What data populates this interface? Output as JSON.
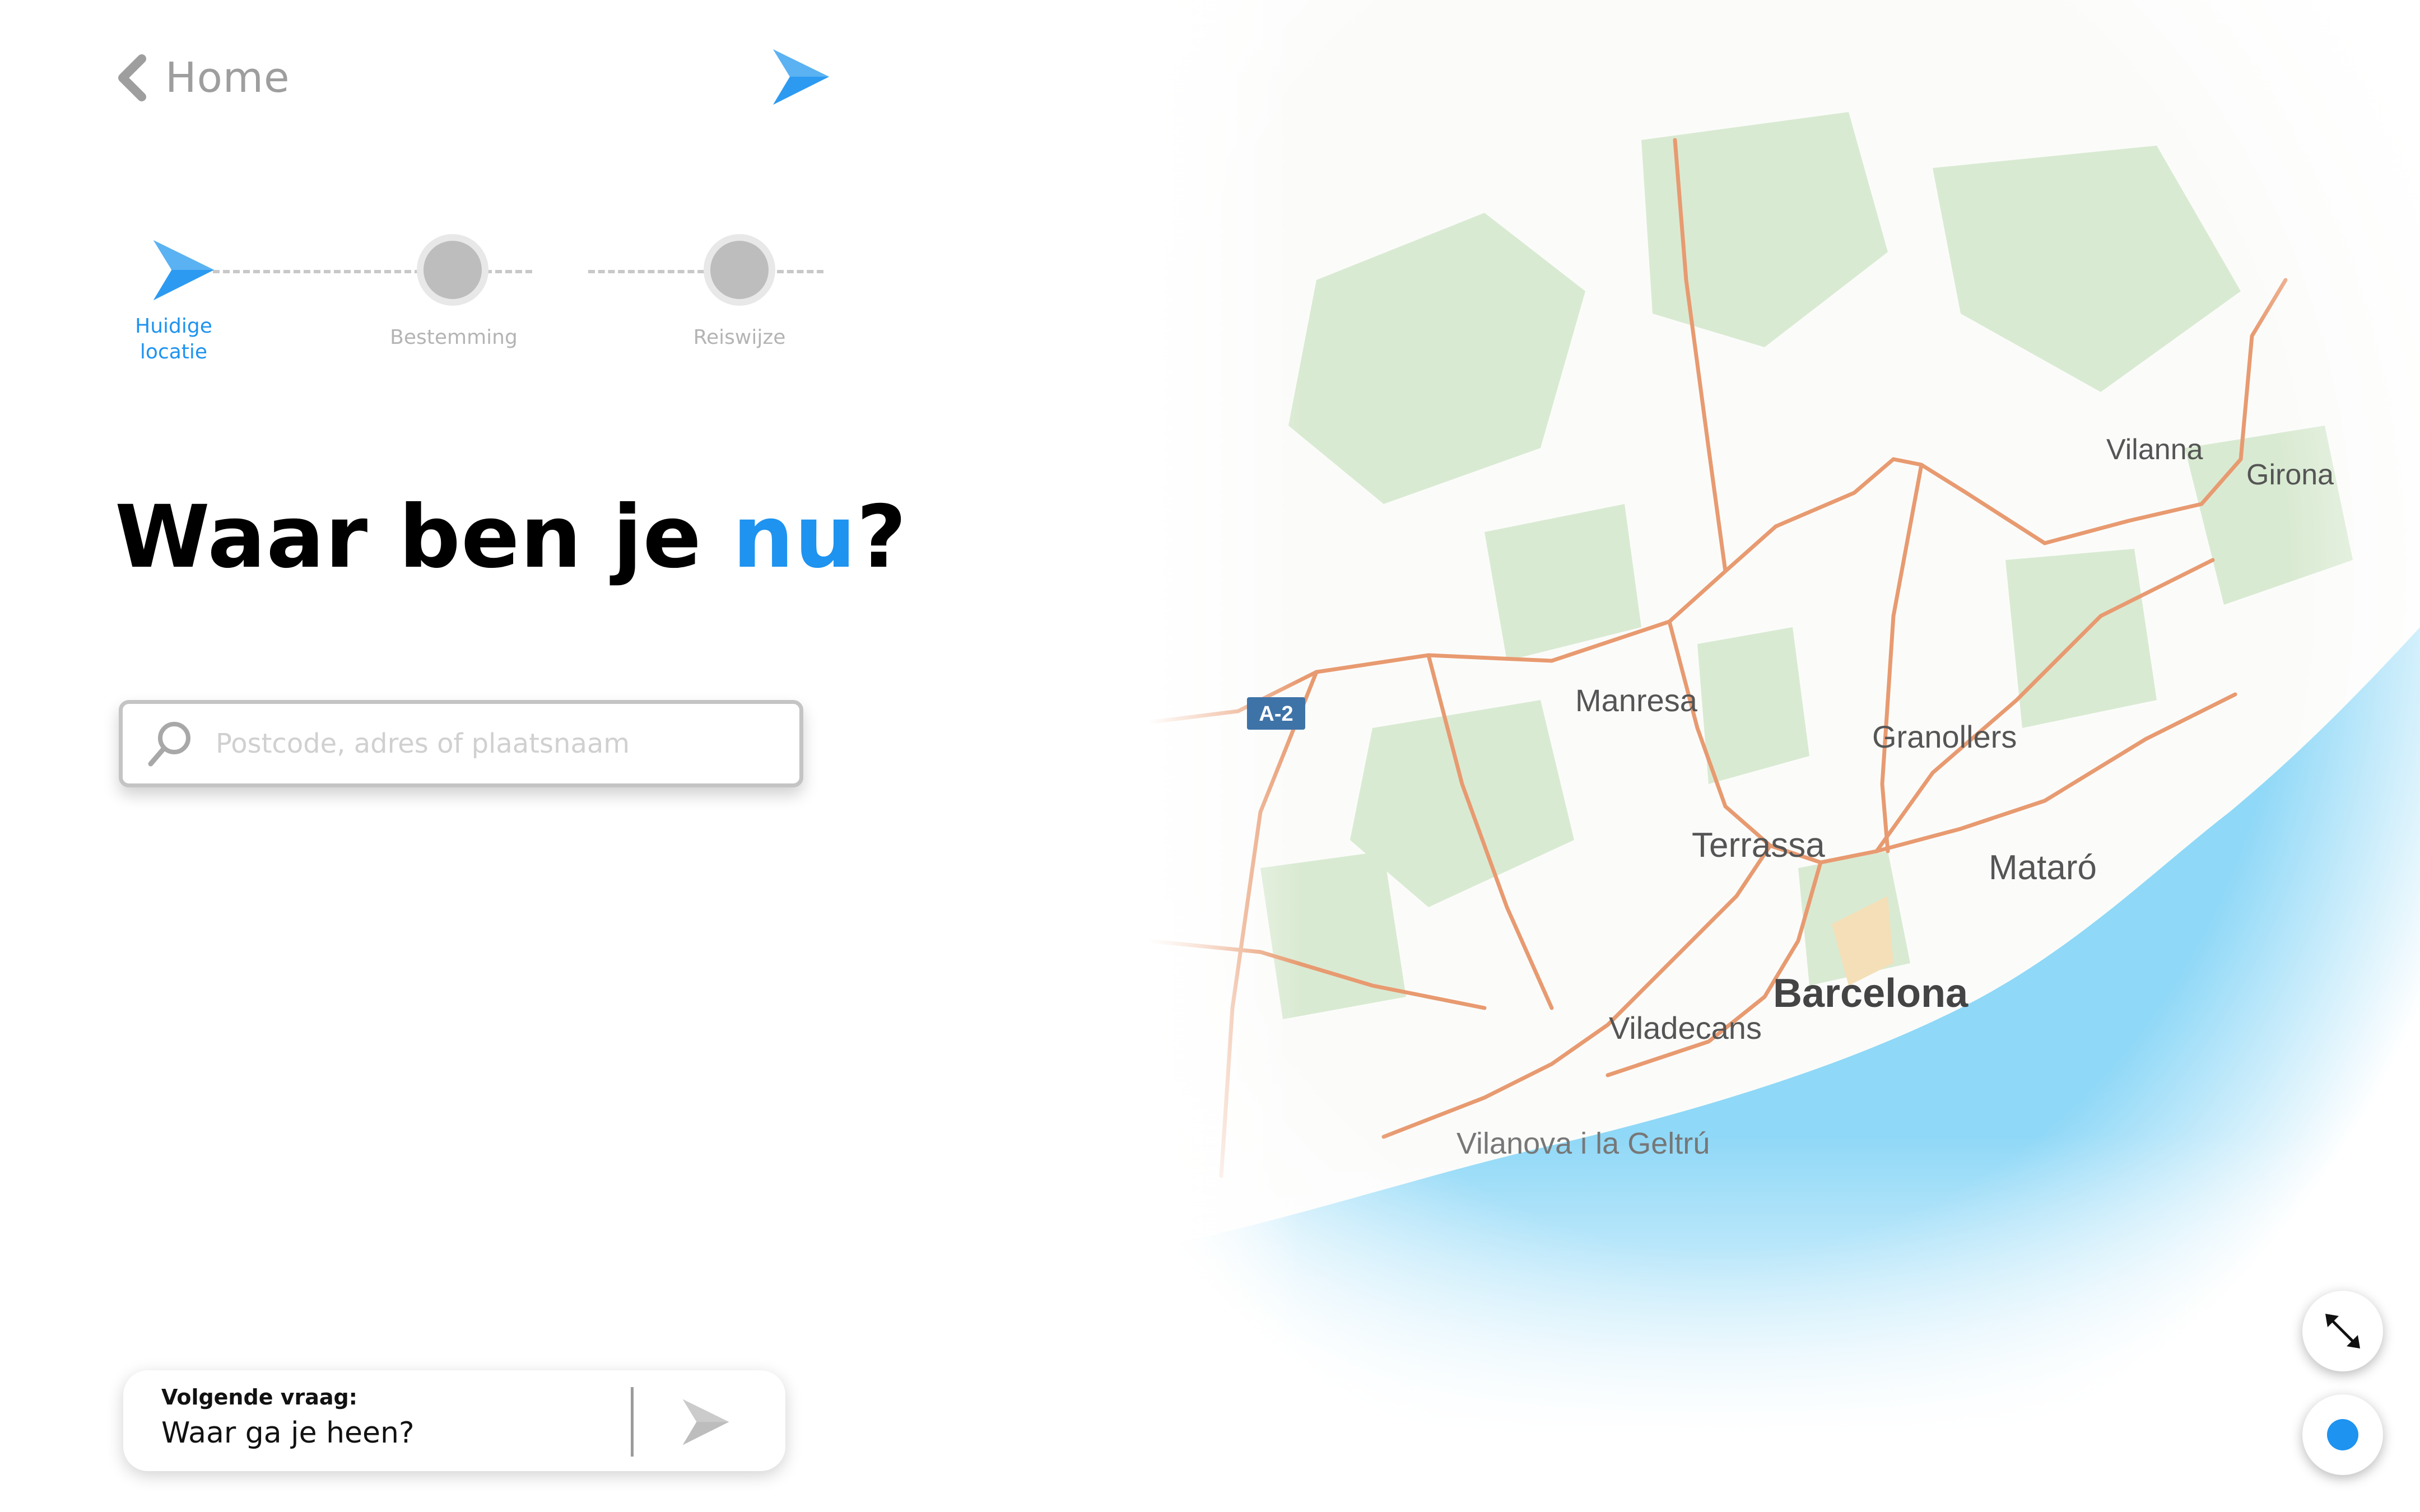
{
  "nav": {
    "back_label": "Home"
  },
  "stepper": {
    "steps": [
      {
        "label": "Huidige\nlocatie",
        "state": "active"
      },
      {
        "label": "Bestemming",
        "state": "pending"
      },
      {
        "label": "Reiswijze",
        "state": "pending"
      }
    ]
  },
  "question": {
    "before": "Waar ben je ",
    "accent": "nu",
    "after": "?"
  },
  "search": {
    "placeholder": "Postcode, adres of plaatsnaam",
    "value": ""
  },
  "next_question": {
    "label": "Volgende vraag:",
    "text": "Waar ga je heen?"
  },
  "map": {
    "road_shield": "A-2",
    "places": [
      "Vilanna",
      "Girona",
      "Manresa",
      "Granollers",
      "Terrassa",
      "Mataró",
      "Barcelona",
      "Viladecans",
      "Vilanova i la Geltrú"
    ]
  },
  "colors": {
    "accent": "#1e93f0",
    "logo_light": "#7cc3f7",
    "road": "#e89a70",
    "sea": "#8fd8f7",
    "forest": "#d7e8d0"
  }
}
